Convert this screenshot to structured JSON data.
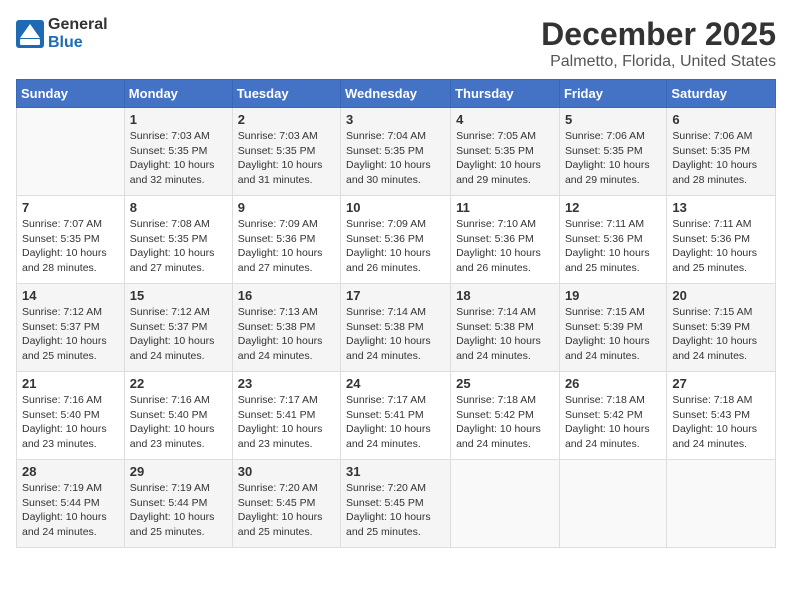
{
  "header": {
    "logo": {
      "general": "General",
      "blue": "Blue"
    },
    "title": "December 2025",
    "subtitle": "Palmetto, Florida, United States"
  },
  "calendar": {
    "days_header": [
      "Sunday",
      "Monday",
      "Tuesday",
      "Wednesday",
      "Thursday",
      "Friday",
      "Saturday"
    ],
    "weeks": [
      [
        {
          "day": "",
          "info": ""
        },
        {
          "day": "1",
          "info": "Sunrise: 7:03 AM\nSunset: 5:35 PM\nDaylight: 10 hours\nand 32 minutes."
        },
        {
          "day": "2",
          "info": "Sunrise: 7:03 AM\nSunset: 5:35 PM\nDaylight: 10 hours\nand 31 minutes."
        },
        {
          "day": "3",
          "info": "Sunrise: 7:04 AM\nSunset: 5:35 PM\nDaylight: 10 hours\nand 30 minutes."
        },
        {
          "day": "4",
          "info": "Sunrise: 7:05 AM\nSunset: 5:35 PM\nDaylight: 10 hours\nand 29 minutes."
        },
        {
          "day": "5",
          "info": "Sunrise: 7:06 AM\nSunset: 5:35 PM\nDaylight: 10 hours\nand 29 minutes."
        },
        {
          "day": "6",
          "info": "Sunrise: 7:06 AM\nSunset: 5:35 PM\nDaylight: 10 hours\nand 28 minutes."
        }
      ],
      [
        {
          "day": "7",
          "info": "Sunrise: 7:07 AM\nSunset: 5:35 PM\nDaylight: 10 hours\nand 28 minutes."
        },
        {
          "day": "8",
          "info": "Sunrise: 7:08 AM\nSunset: 5:35 PM\nDaylight: 10 hours\nand 27 minutes."
        },
        {
          "day": "9",
          "info": "Sunrise: 7:09 AM\nSunset: 5:36 PM\nDaylight: 10 hours\nand 27 minutes."
        },
        {
          "day": "10",
          "info": "Sunrise: 7:09 AM\nSunset: 5:36 PM\nDaylight: 10 hours\nand 26 minutes."
        },
        {
          "day": "11",
          "info": "Sunrise: 7:10 AM\nSunset: 5:36 PM\nDaylight: 10 hours\nand 26 minutes."
        },
        {
          "day": "12",
          "info": "Sunrise: 7:11 AM\nSunset: 5:36 PM\nDaylight: 10 hours\nand 25 minutes."
        },
        {
          "day": "13",
          "info": "Sunrise: 7:11 AM\nSunset: 5:36 PM\nDaylight: 10 hours\nand 25 minutes."
        }
      ],
      [
        {
          "day": "14",
          "info": "Sunrise: 7:12 AM\nSunset: 5:37 PM\nDaylight: 10 hours\nand 25 minutes."
        },
        {
          "day": "15",
          "info": "Sunrise: 7:12 AM\nSunset: 5:37 PM\nDaylight: 10 hours\nand 24 minutes."
        },
        {
          "day": "16",
          "info": "Sunrise: 7:13 AM\nSunset: 5:38 PM\nDaylight: 10 hours\nand 24 minutes."
        },
        {
          "day": "17",
          "info": "Sunrise: 7:14 AM\nSunset: 5:38 PM\nDaylight: 10 hours\nand 24 minutes."
        },
        {
          "day": "18",
          "info": "Sunrise: 7:14 AM\nSunset: 5:38 PM\nDaylight: 10 hours\nand 24 minutes."
        },
        {
          "day": "19",
          "info": "Sunrise: 7:15 AM\nSunset: 5:39 PM\nDaylight: 10 hours\nand 24 minutes."
        },
        {
          "day": "20",
          "info": "Sunrise: 7:15 AM\nSunset: 5:39 PM\nDaylight: 10 hours\nand 24 minutes."
        }
      ],
      [
        {
          "day": "21",
          "info": "Sunrise: 7:16 AM\nSunset: 5:40 PM\nDaylight: 10 hours\nand 23 minutes."
        },
        {
          "day": "22",
          "info": "Sunrise: 7:16 AM\nSunset: 5:40 PM\nDaylight: 10 hours\nand 23 minutes."
        },
        {
          "day": "23",
          "info": "Sunrise: 7:17 AM\nSunset: 5:41 PM\nDaylight: 10 hours\nand 23 minutes."
        },
        {
          "day": "24",
          "info": "Sunrise: 7:17 AM\nSunset: 5:41 PM\nDaylight: 10 hours\nand 24 minutes."
        },
        {
          "day": "25",
          "info": "Sunrise: 7:18 AM\nSunset: 5:42 PM\nDaylight: 10 hours\nand 24 minutes."
        },
        {
          "day": "26",
          "info": "Sunrise: 7:18 AM\nSunset: 5:42 PM\nDaylight: 10 hours\nand 24 minutes."
        },
        {
          "day": "27",
          "info": "Sunrise: 7:18 AM\nSunset: 5:43 PM\nDaylight: 10 hours\nand 24 minutes."
        }
      ],
      [
        {
          "day": "28",
          "info": "Sunrise: 7:19 AM\nSunset: 5:44 PM\nDaylight: 10 hours\nand 24 minutes."
        },
        {
          "day": "29",
          "info": "Sunrise: 7:19 AM\nSunset: 5:44 PM\nDaylight: 10 hours\nand 25 minutes."
        },
        {
          "day": "30",
          "info": "Sunrise: 7:20 AM\nSunset: 5:45 PM\nDaylight: 10 hours\nand 25 minutes."
        },
        {
          "day": "31",
          "info": "Sunrise: 7:20 AM\nSunset: 5:45 PM\nDaylight: 10 hours\nand 25 minutes."
        },
        {
          "day": "",
          "info": ""
        },
        {
          "day": "",
          "info": ""
        },
        {
          "day": "",
          "info": ""
        }
      ]
    ]
  }
}
